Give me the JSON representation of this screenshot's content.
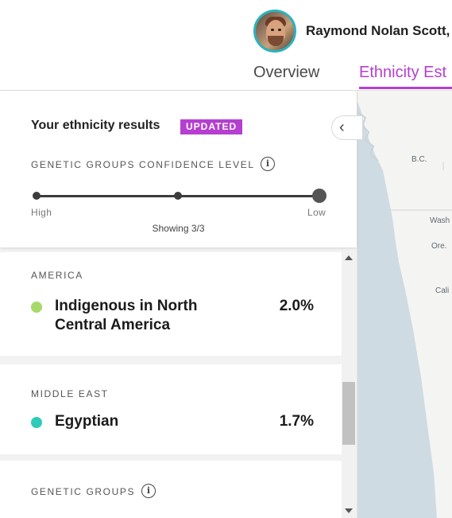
{
  "header": {
    "user_name": "Raymond Nolan Scott,",
    "tabs": [
      {
        "label": "Overview",
        "active": false
      },
      {
        "label": "Ethnicity Est",
        "active": true
      }
    ]
  },
  "results": {
    "title": "Your ethnicity results",
    "badge": "UPDATED",
    "confidence_label": "GENETIC GROUPS CONFIDENCE LEVEL",
    "slider": {
      "high_label": "High",
      "low_label": "Low",
      "selected_step": 3,
      "total_steps": 3,
      "showing_text": "Showing 3/3"
    }
  },
  "regions": [
    {
      "label": "AMERICA",
      "items": [
        {
          "name": "Indigenous in North Central America",
          "percent": "2.0%",
          "color": "#a6d96a"
        }
      ]
    },
    {
      "label": "MIDDLE EAST",
      "items": [
        {
          "name": "Egyptian",
          "percent": "1.7%",
          "color": "#2ecbb8"
        }
      ]
    }
  ],
  "genetic_groups": {
    "label": "GENETIC GROUPS"
  },
  "map": {
    "labels": [
      "B.C.",
      "Wash",
      "Ore.",
      "Cali"
    ]
  },
  "colors": {
    "accent": "#b43fd0",
    "avatar_ring": "#2bb3c0",
    "map_water": "#cfdbe3",
    "map_land": "#f4f4f2"
  },
  "icons": {
    "collapse": "chevron-left-icon",
    "info": "info-icon",
    "scroll_up": "triangle-up-icon",
    "scroll_down": "triangle-down-icon"
  }
}
